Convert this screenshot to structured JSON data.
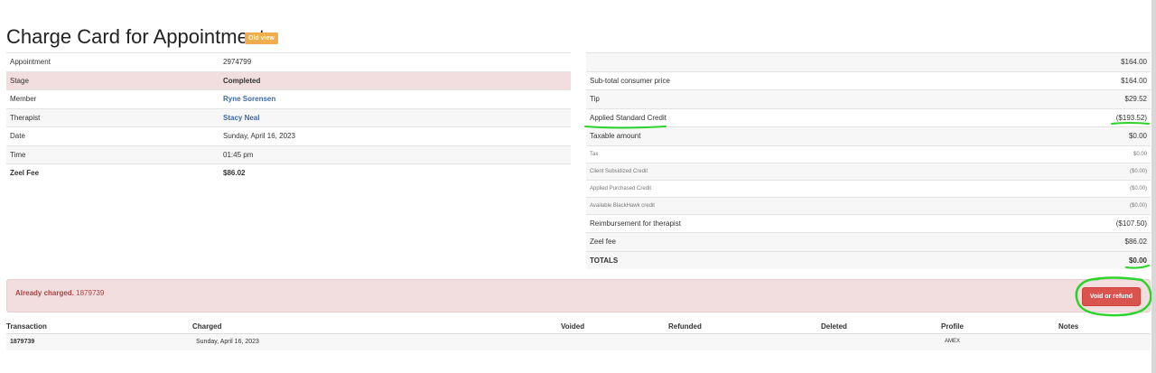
{
  "page": {
    "title": "Charge Card for Appointment",
    "badge": "Old view"
  },
  "details": [
    {
      "key": "Appointment",
      "value": "2974799"
    },
    {
      "key": "Stage",
      "value": "Completed"
    },
    {
      "key": "Member",
      "value": "Ryne Sorensen"
    },
    {
      "key": "Therapist",
      "value": "Stacy Neal"
    },
    {
      "key": "Date",
      "value": "Sunday, April 16, 2023"
    },
    {
      "key": "Time",
      "value": "01:45 pm"
    },
    {
      "key": "Zeel Fee",
      "value": "$86.02"
    }
  ],
  "pricing": [
    {
      "key": "",
      "value": "$164.00"
    },
    {
      "key": "Sub-total consumer price",
      "value": "$164.00"
    },
    {
      "key": "Tip",
      "value": "$29.52"
    },
    {
      "key": "Applied Standard Credit",
      "value": "($193.52)"
    },
    {
      "key": "Taxable amount",
      "value": "$0.00"
    },
    {
      "key": "Tax",
      "value": "$0.00"
    },
    {
      "key": "Client Subsidized Credit",
      "value": "($0.00)"
    },
    {
      "key": "Applied Purchased Credit",
      "value": "($0.00)"
    },
    {
      "key": "Available BlackHawk credit",
      "value": "($0.00)"
    },
    {
      "key": "Reimbursement for therapist",
      "value": "($107.50)"
    },
    {
      "key": "Zeel fee",
      "value": "$86.02"
    },
    {
      "key": "TOTALS",
      "value": "$0.00"
    }
  ],
  "alert": {
    "label": "Already charged.",
    "id": "1879739",
    "button": "Void or refund"
  },
  "transactions": {
    "headers": [
      "Transaction",
      "Charged",
      "Voided",
      "Refunded",
      "Deleted",
      "Profile",
      "Notes"
    ],
    "rows": [
      {
        "transaction": "1879739",
        "charged": "Sunday, April 16, 2023",
        "voided": "",
        "refunded": "",
        "deleted": "",
        "profile": "AMEX",
        "notes": ""
      }
    ]
  },
  "colors": {
    "annotation": "#2bd32b",
    "danger": "#d9534f",
    "alert_bg": "#f2dede",
    "badge": "#f0ad4e",
    "link": "#3b6aa8"
  }
}
